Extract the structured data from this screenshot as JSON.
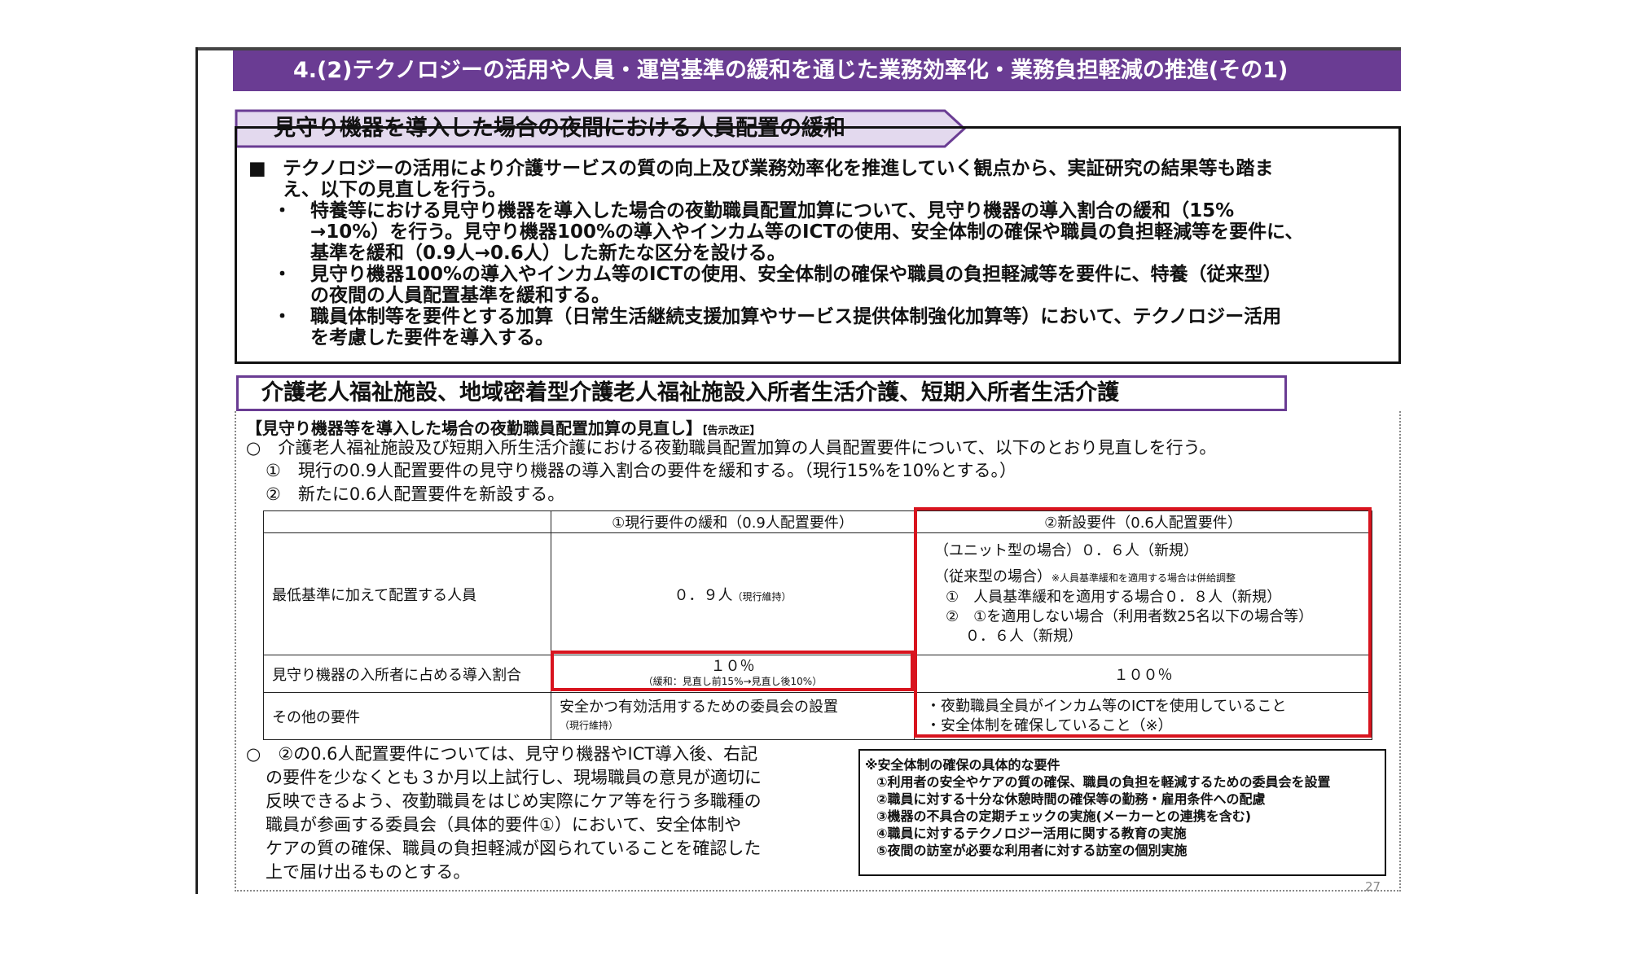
{
  "header": {
    "title": "4.(2)テクノロジーの活用や人員・運営基準の緩和を通じた業務効率化・業務負担軽減の推進(その1)"
  },
  "section1": {
    "title": "見守り機器を導入した場合の夜間における人員配置の緩和",
    "lead_marker": "■",
    "lead_line1": "テクノロジーの活用により介護サービスの質の向上及び業務効率化を推進していく観点から、実証研究の結果等も踏ま",
    "lead_line2": "え、以下の見直しを行う。",
    "bullet_marker": "・",
    "bullets": [
      {
        "line1": "特養等における見守り機器を導入した場合の夜勤職員配置加算について、見守り機器の導入割合の緩和（15%",
        "line2": "→10%）を行う。見守り機器100%の導入やインカム等のICTの使用、安全体制の確保や職員の負担軽減等を要件に、",
        "line3": "基準を緩和（0.9人→0.6人）した新たな区分を設ける。"
      },
      {
        "line1": "見守り機器100%の導入やインカム等のICTの使用、安全体制の確保や職員の負担軽減等を要件に、特養（従来型）",
        "line2": "の夜間の人員配置基準を緩和する。"
      },
      {
        "line1": "職員体制等を要件とする加算（日常生活継続支援加算やサービス提供体制強化加算等）において、テクノロジー活用",
        "line2": "を考慮した要件を導入する。"
      }
    ]
  },
  "section2": {
    "title": "介護老人福祉施設、地域密着型介護老人福祉施設入所者生活介護、短期入所者生活介護",
    "subheading": "【見守り機器等を導入した場合の夜勤職員配置加算の見直し】",
    "subheading_tag": "【告示改正】",
    "para1": "○　介護老人福祉施設及び短期入所生活介護における夜勤職員配置加算の人員配置要件について、以下のとおり見直しを行う。",
    "para1_item1": "①　現行の0.9人配置要件の見守り機器の導入割合の要件を緩和する。（現行15%を10%とする。）",
    "para1_item2": "②　新たに0.6人配置要件を新設する。",
    "table": {
      "col1_header": "①現行要件の緩和（0.9人配置要件）",
      "col2_header": "②新設要件（0.6人配置要件）",
      "row1_label": "最低基準に加えて配置する人員",
      "row1_col1": "０．９人",
      "row1_col1_note": "（現行維持）",
      "row1_col2_line1": "（ユニット型の場合）０．６人（新規）",
      "row1_col2_line2": "（従来型の場合）",
      "row1_col2_line2_note": "※人員基準緩和を適用する場合は併給調整",
      "row1_col2_line3": "①　人員基準緩和を適用する場合０．８人（新規）",
      "row1_col2_line4": "②　①を適用しない場合（利用者数25名以下の場合等）",
      "row1_col2_line5": "０．６人（新規）",
      "row2_label": "見守り機器の入所者に占める導入割合",
      "row2_col1": "１０％",
      "row2_col1_note": "（緩和：見直し前15%→見直し後10%）",
      "row2_col2": "１００％",
      "row3_label": "その他の要件",
      "row3_col1": "安全かつ有効活用するための委員会の設置",
      "row3_col1_note": "（現行維持）",
      "row3_col2_line1": "・夜勤職員全員がインカム等のICTを使用していること",
      "row3_col2_line2": "・安全体制を確保していること（※）"
    },
    "para2_lines": [
      "○　②の0.6人配置要件については、見守り機器やICT導入後、右記",
      "の要件を少なくとも３か月以上試行し、現場職員の意見が適切に",
      "反映できるよう、夜勤職員をはじめ実際にケア等を行う多職種の",
      "職員が参画する委員会（具体的要件①）において、安全体制や",
      "ケアの質の確保、職員の負担軽減が図られていることを確認した",
      "上で届け出るものとする。"
    ],
    "safety_box": {
      "title": "※安全体制の確保の具体的な要件",
      "items": [
        "①利用者の安全やケアの質の確保、職員の負担を軽減するための委員会を設置",
        "②職員に対する十分な休憩時間の確保等の勤務・雇用条件への配慮",
        "③機器の不具合の定期チェックの実施(メーカーとの連携を含む)",
        "④職員に対するテクノロジー活用に関する教育の実施",
        "⑤夜間の訪室が必要な利用者に対する訪室の個別実施"
      ]
    }
  },
  "page_number": "27",
  "colors": {
    "header_bg": "#6a3c93",
    "title_tab_bg": "#e3d9ee",
    "highlight_red": "#d8141e"
  }
}
